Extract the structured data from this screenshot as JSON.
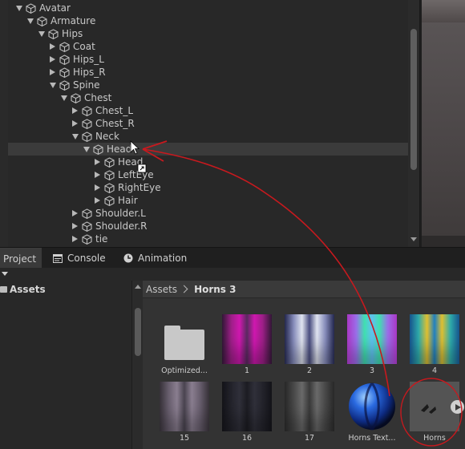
{
  "hierarchy": {
    "rows": [
      {
        "label": "Avatar",
        "depth": 0,
        "arrow": "down"
      },
      {
        "label": "Armature",
        "depth": 1,
        "arrow": "down"
      },
      {
        "label": "Hips",
        "depth": 2,
        "arrow": "down"
      },
      {
        "label": "Coat",
        "depth": 3,
        "arrow": "right"
      },
      {
        "label": "Hips_L",
        "depth": 3,
        "arrow": "right"
      },
      {
        "label": "Hips_R",
        "depth": 3,
        "arrow": "right"
      },
      {
        "label": "Spine",
        "depth": 3,
        "arrow": "down"
      },
      {
        "label": "Chest",
        "depth": 4,
        "arrow": "down"
      },
      {
        "label": "Chest_L",
        "depth": 5,
        "arrow": "right"
      },
      {
        "label": "Chest_R",
        "depth": 5,
        "arrow": "right"
      },
      {
        "label": "Neck",
        "depth": 5,
        "arrow": "down"
      },
      {
        "label": "Head",
        "depth": 6,
        "arrow": "down",
        "selected": true
      },
      {
        "label": "Head",
        "depth": 7,
        "arrow": "right"
      },
      {
        "label": "LeftEye",
        "depth": 7,
        "arrow": "right"
      },
      {
        "label": "RightEye",
        "depth": 7,
        "arrow": "right"
      },
      {
        "label": "Hair",
        "depth": 7,
        "arrow": "right"
      },
      {
        "label": "Shoulder.L",
        "depth": 5,
        "arrow": "right"
      },
      {
        "label": "Shoulder.R",
        "depth": 5,
        "arrow": "right"
      },
      {
        "label": "tie",
        "depth": 5,
        "arrow": "right"
      }
    ]
  },
  "tabs": {
    "project": "Project",
    "console": "Console",
    "animation": "Animation"
  },
  "project": {
    "root_folder": "Assets",
    "breadcrumb": [
      "Assets",
      "Horns 3"
    ],
    "assets": [
      {
        "label": "Optimized...",
        "kind": "folder"
      },
      {
        "label": "1",
        "kind": "texture",
        "colors": [
          "#3a1a3e",
          "#a0208a",
          "#d018b0",
          "#5a2a60"
        ]
      },
      {
        "label": "2",
        "kind": "texture",
        "colors": [
          "#2a2e5a",
          "#8a90c0",
          "#e0e4f0",
          "#4a4e80"
        ]
      },
      {
        "label": "3",
        "kind": "texture",
        "colors": [
          "#c040e0",
          "#a070f0",
          "#40e0b0",
          "#60c0f0"
        ]
      },
      {
        "label": "4",
        "kind": "texture",
        "colors": [
          "#1a60a0",
          "#30b0b0",
          "#e0c030",
          "#2080c0"
        ]
      },
      {
        "label": "15",
        "kind": "texture",
        "colors": [
          "#3e3840",
          "#6a6070",
          "#8a7e90",
          "#4a4450"
        ]
      },
      {
        "label": "16",
        "kind": "texture",
        "colors": [
          "#16161c",
          "#24242c",
          "#30303a",
          "#1c1c22"
        ]
      },
      {
        "label": "17",
        "kind": "texture",
        "colors": [
          "#2e2e2e",
          "#4a4a4a",
          "#6a6a6a",
          "#3a3a3a"
        ]
      },
      {
        "label": "Horns Text...",
        "kind": "material"
      },
      {
        "label": "Horns",
        "kind": "mesh",
        "selected": true
      }
    ]
  },
  "colors": {
    "annotation_red": "#c8191e",
    "panel_bg": "#282828",
    "selection_row": "#3b3b3b"
  }
}
